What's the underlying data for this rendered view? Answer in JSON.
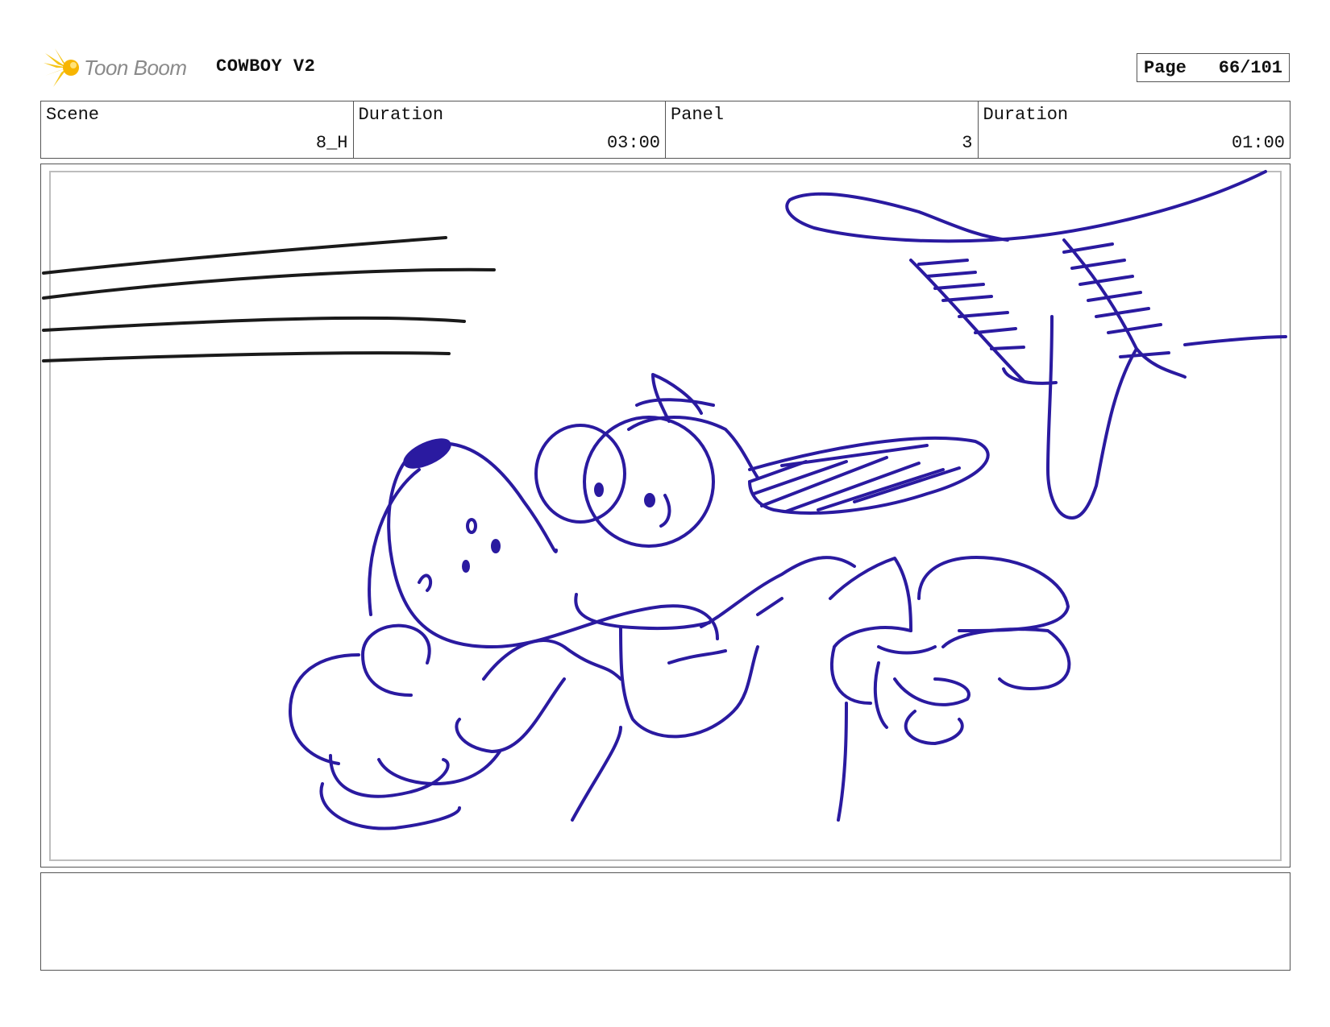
{
  "header": {
    "logo_text": "Toon Boom",
    "project_title": "COWBOY V2",
    "page_label": "Page",
    "page_number": "66/101"
  },
  "info": {
    "scene_label": "Scene",
    "scene_value": "8_H",
    "scene_duration_label": "Duration",
    "scene_duration_value": "03:00",
    "panel_label": "Panel",
    "panel_value": "3",
    "panel_duration_label": "Duration",
    "panel_duration_value": "01:00"
  },
  "panel": {
    "sketch_color": "#2a1aa0",
    "speed_line_color": "#1a1a1a"
  },
  "notes": {
    "text": ""
  },
  "colors": {
    "logo_star": "#f5c518",
    "logo_text": "#8a8a8a",
    "border": "#555555",
    "inner_border": "#bdbdbd"
  }
}
